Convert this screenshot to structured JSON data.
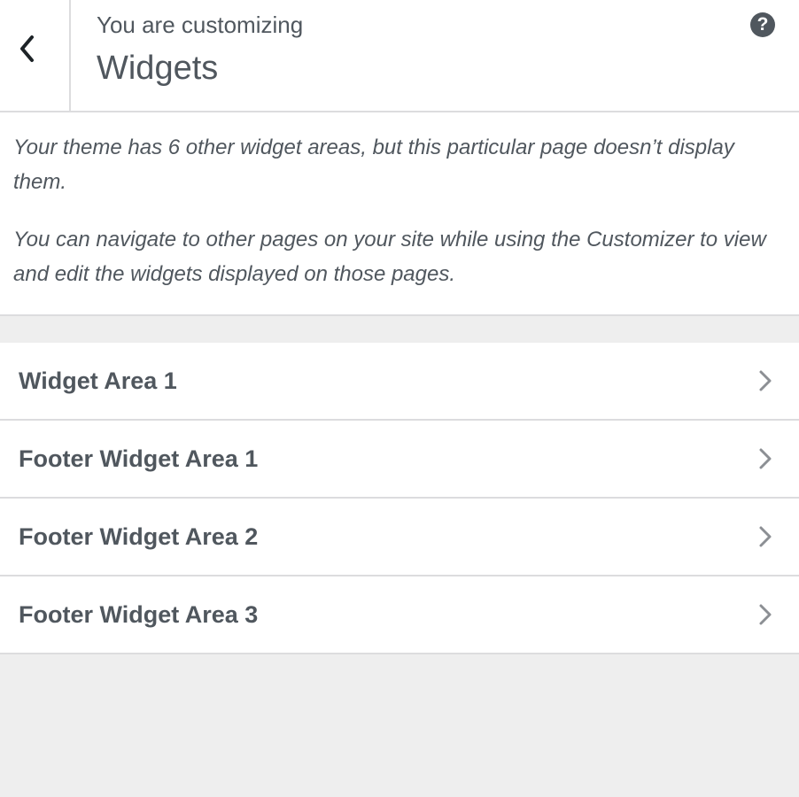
{
  "header": {
    "eyebrow": "You are customizing",
    "title": "Widgets",
    "back_icon": "chevron-left-icon",
    "help_icon": "help-icon",
    "help_glyph": "?"
  },
  "description": {
    "paragraphs": [
      "Your theme has 6 other widget areas, but this particular page doesn’t display them.",
      "You can navigate to other pages on your site while using the Customizer to view and edit the widgets displayed on those pages."
    ]
  },
  "sections": [
    {
      "label": "Widget Area 1"
    },
    {
      "label": "Footer Widget Area 1"
    },
    {
      "label": "Footer Widget Area 2"
    },
    {
      "label": "Footer Widget Area 3"
    }
  ],
  "colors": {
    "text": "#50575e",
    "border": "#dcdcde",
    "background": "#eeeeee",
    "panel": "#ffffff"
  }
}
